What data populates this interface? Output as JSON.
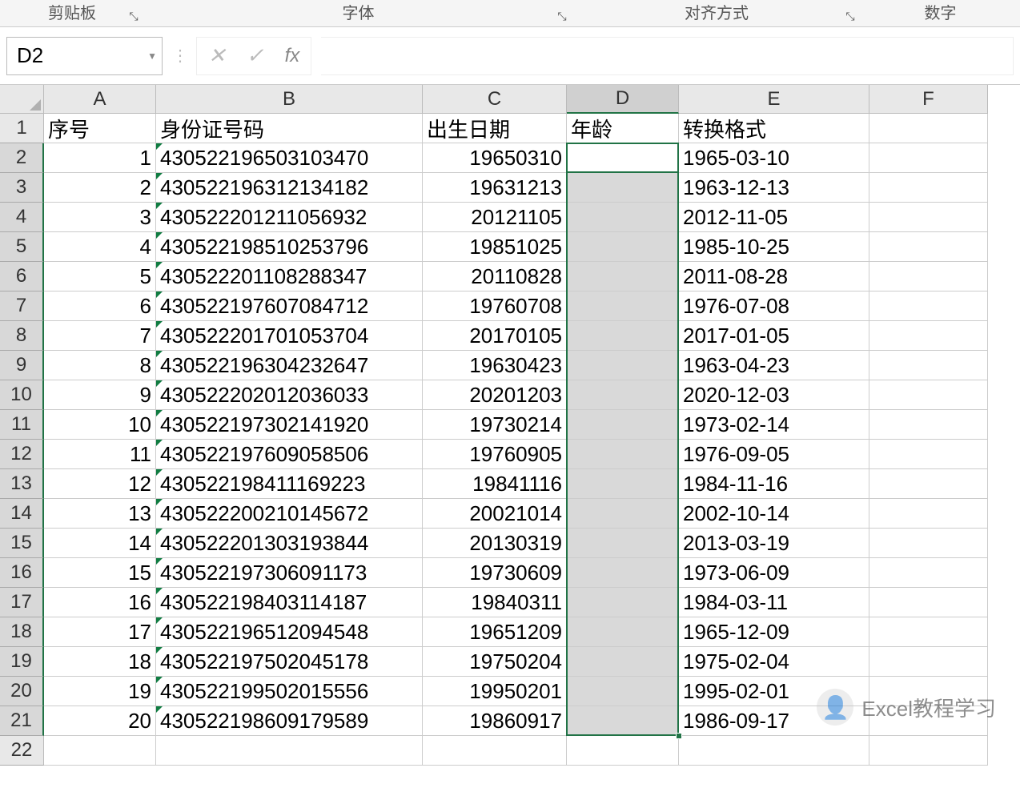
{
  "ribbon": {
    "groups": {
      "clipboard": "剪贴板",
      "font": "字体",
      "alignment": "对齐方式",
      "number": "数字"
    }
  },
  "name_box": "D2",
  "formula_input": "",
  "columns": [
    "A",
    "B",
    "C",
    "D",
    "E",
    "F"
  ],
  "headers": {
    "A": "序号",
    "B": "身份证号码",
    "C": "出生日期",
    "D": "年龄",
    "E": "转换格式"
  },
  "rows": [
    {
      "n": "1",
      "a": "1",
      "b": "430522196503103470",
      "c": "19650310",
      "d": "",
      "e": "1965-03-10"
    },
    {
      "n": "2",
      "a": "2",
      "b": "430522196312134182",
      "c": "19631213",
      "d": "",
      "e": "1963-12-13"
    },
    {
      "n": "3",
      "a": "3",
      "b": "430522201211056932",
      "c": "20121105",
      "d": "",
      "e": "2012-11-05"
    },
    {
      "n": "4",
      "a": "4",
      "b": "430522198510253796",
      "c": "19851025",
      "d": "",
      "e": "1985-10-25"
    },
    {
      "n": "5",
      "a": "5",
      "b": "430522201108288347",
      "c": "20110828",
      "d": "",
      "e": "2011-08-28"
    },
    {
      "n": "6",
      "a": "6",
      "b": "430522197607084712",
      "c": "19760708",
      "d": "",
      "e": "1976-07-08"
    },
    {
      "n": "7",
      "a": "7",
      "b": "430522201701053704",
      "c": "20170105",
      "d": "",
      "e": "2017-01-05"
    },
    {
      "n": "8",
      "a": "8",
      "b": "430522196304232647",
      "c": "19630423",
      "d": "",
      "e": "1963-04-23"
    },
    {
      "n": "9",
      "a": "9",
      "b": "430522202012036033",
      "c": "20201203",
      "d": "",
      "e": "2020-12-03"
    },
    {
      "n": "10",
      "a": "10",
      "b": "430522197302141920",
      "c": "19730214",
      "d": "",
      "e": "1973-02-14"
    },
    {
      "n": "11",
      "a": "11",
      "b": "430522197609058506",
      "c": "19760905",
      "d": "",
      "e": "1976-09-05"
    },
    {
      "n": "12",
      "a": "12",
      "b": "430522198411169223",
      "c": "19841116",
      "d": "",
      "e": "1984-11-16"
    },
    {
      "n": "13",
      "a": "13",
      "b": "430522200210145672",
      "c": "20021014",
      "d": "",
      "e": "2002-10-14"
    },
    {
      "n": "14",
      "a": "14",
      "b": "430522201303193844",
      "c": "20130319",
      "d": "",
      "e": "2013-03-19"
    },
    {
      "n": "15",
      "a": "15",
      "b": "430522197306091173",
      "c": "19730609",
      "d": "",
      "e": "1973-06-09"
    },
    {
      "n": "16",
      "a": "16",
      "b": "430522198403114187",
      "c": "19840311",
      "d": "",
      "e": "1984-03-11"
    },
    {
      "n": "17",
      "a": "17",
      "b": "430522196512094548",
      "c": "19651209",
      "d": "",
      "e": "1965-12-09"
    },
    {
      "n": "18",
      "a": "18",
      "b": "430522197502045178",
      "c": "19750204",
      "d": "",
      "e": "1975-02-04"
    },
    {
      "n": "19",
      "a": "19",
      "b": "430522199502015556",
      "c": "19950201",
      "d": "",
      "e": "1995-02-01"
    },
    {
      "n": "20",
      "a": "20",
      "b": "430522198609179589",
      "c": "19860917",
      "d": "",
      "e": "1986-09-17"
    }
  ],
  "watermark": "Excel教程学习"
}
